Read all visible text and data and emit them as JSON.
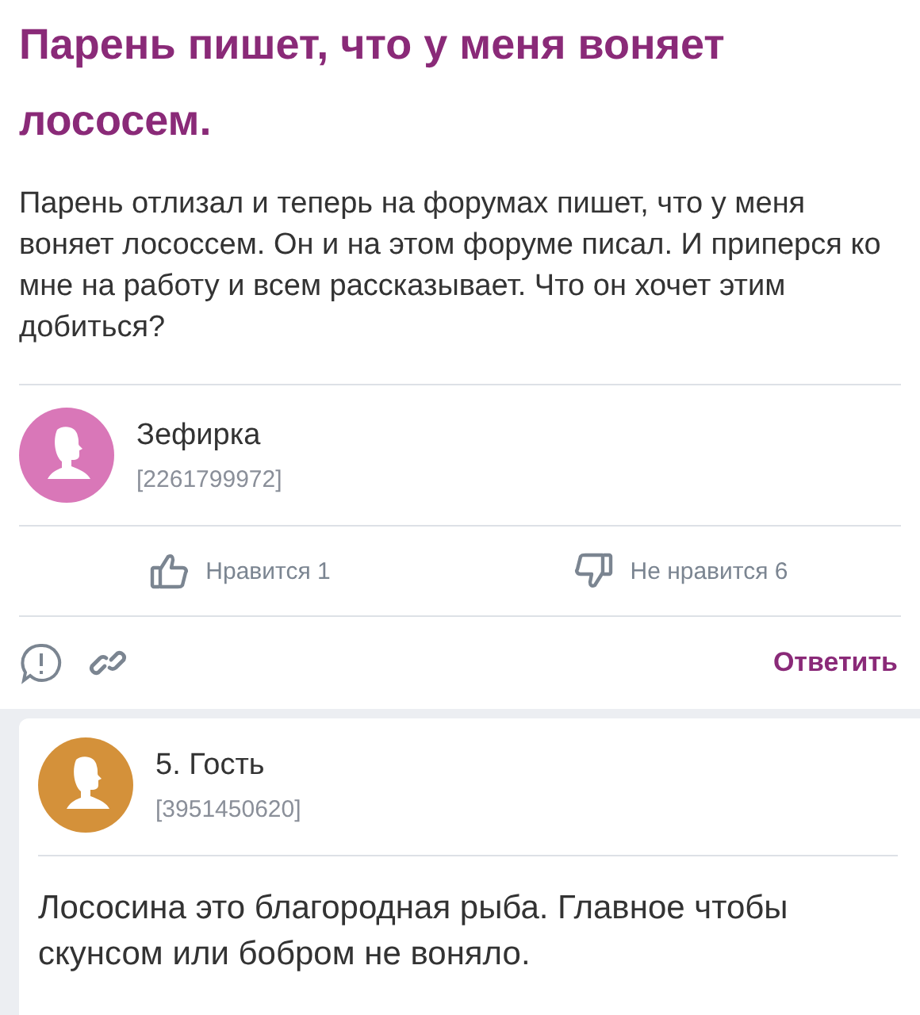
{
  "title": "Парень пишет, что у меня воняет лососем.",
  "body": "Парень отлизал и теперь на форумах пишет, что у меня воняет лососсем. Он и на этом форуме писал. И приперся ко мне на работу и всем рассказывает. Что он хочет этим добиться?",
  "author": {
    "name": "Зефирка",
    "id": "[2261799972]",
    "color": "#d977b8"
  },
  "votes": [
    {
      "kind": "like",
      "label": "Нравится 1"
    },
    {
      "kind": "dislike",
      "label": "Не нравится 6"
    }
  ],
  "reply_button": "Ответить",
  "replies": [
    {
      "name": "5. Гость",
      "id": "[3951450620]",
      "color": "#d4913a",
      "text": "Лососина это благородная рыба. Главное чтобы скунсом или бобром не воняло."
    }
  ]
}
